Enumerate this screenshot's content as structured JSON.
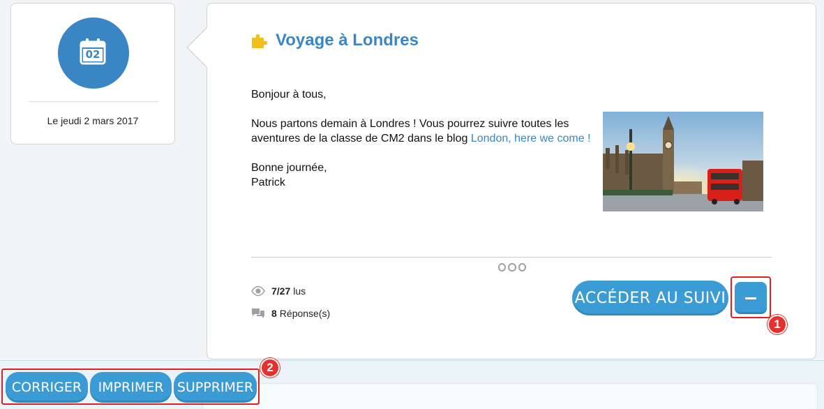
{
  "date_card": {
    "day_number": "02",
    "date_text": "Le jeudi 2 mars 2017"
  },
  "post": {
    "title": "Voyage à Londres",
    "greeting": "Bonjour à tous,",
    "paragraph_text": "Nous partons demain à Londres ! Vous pourrez suivre toutes les aventures de la classe de CM2 dans le blog ",
    "link_text": "London, here we come !",
    "closing": "Bonne journée,",
    "signature": "Patrick",
    "image_icon": "london-photo"
  },
  "stats": {
    "read_count": "7/27",
    "read_label": "lus",
    "reply_count": "8",
    "reply_label": "Réponse(s)"
  },
  "actions": {
    "access_label": "ACCÉDER AU SUIVI",
    "collapse_icon": "minus-icon",
    "correct_label": "CORRIGER",
    "print_label": "IMPRIMER",
    "delete_label": "SUPPRIMER"
  },
  "annotations": {
    "badge_1": "1",
    "badge_2": "2"
  },
  "colors": {
    "accent": "#3a86c4",
    "button": "#3a9bd5",
    "highlight": "#e02020",
    "puzzle": "#f2c01a"
  }
}
